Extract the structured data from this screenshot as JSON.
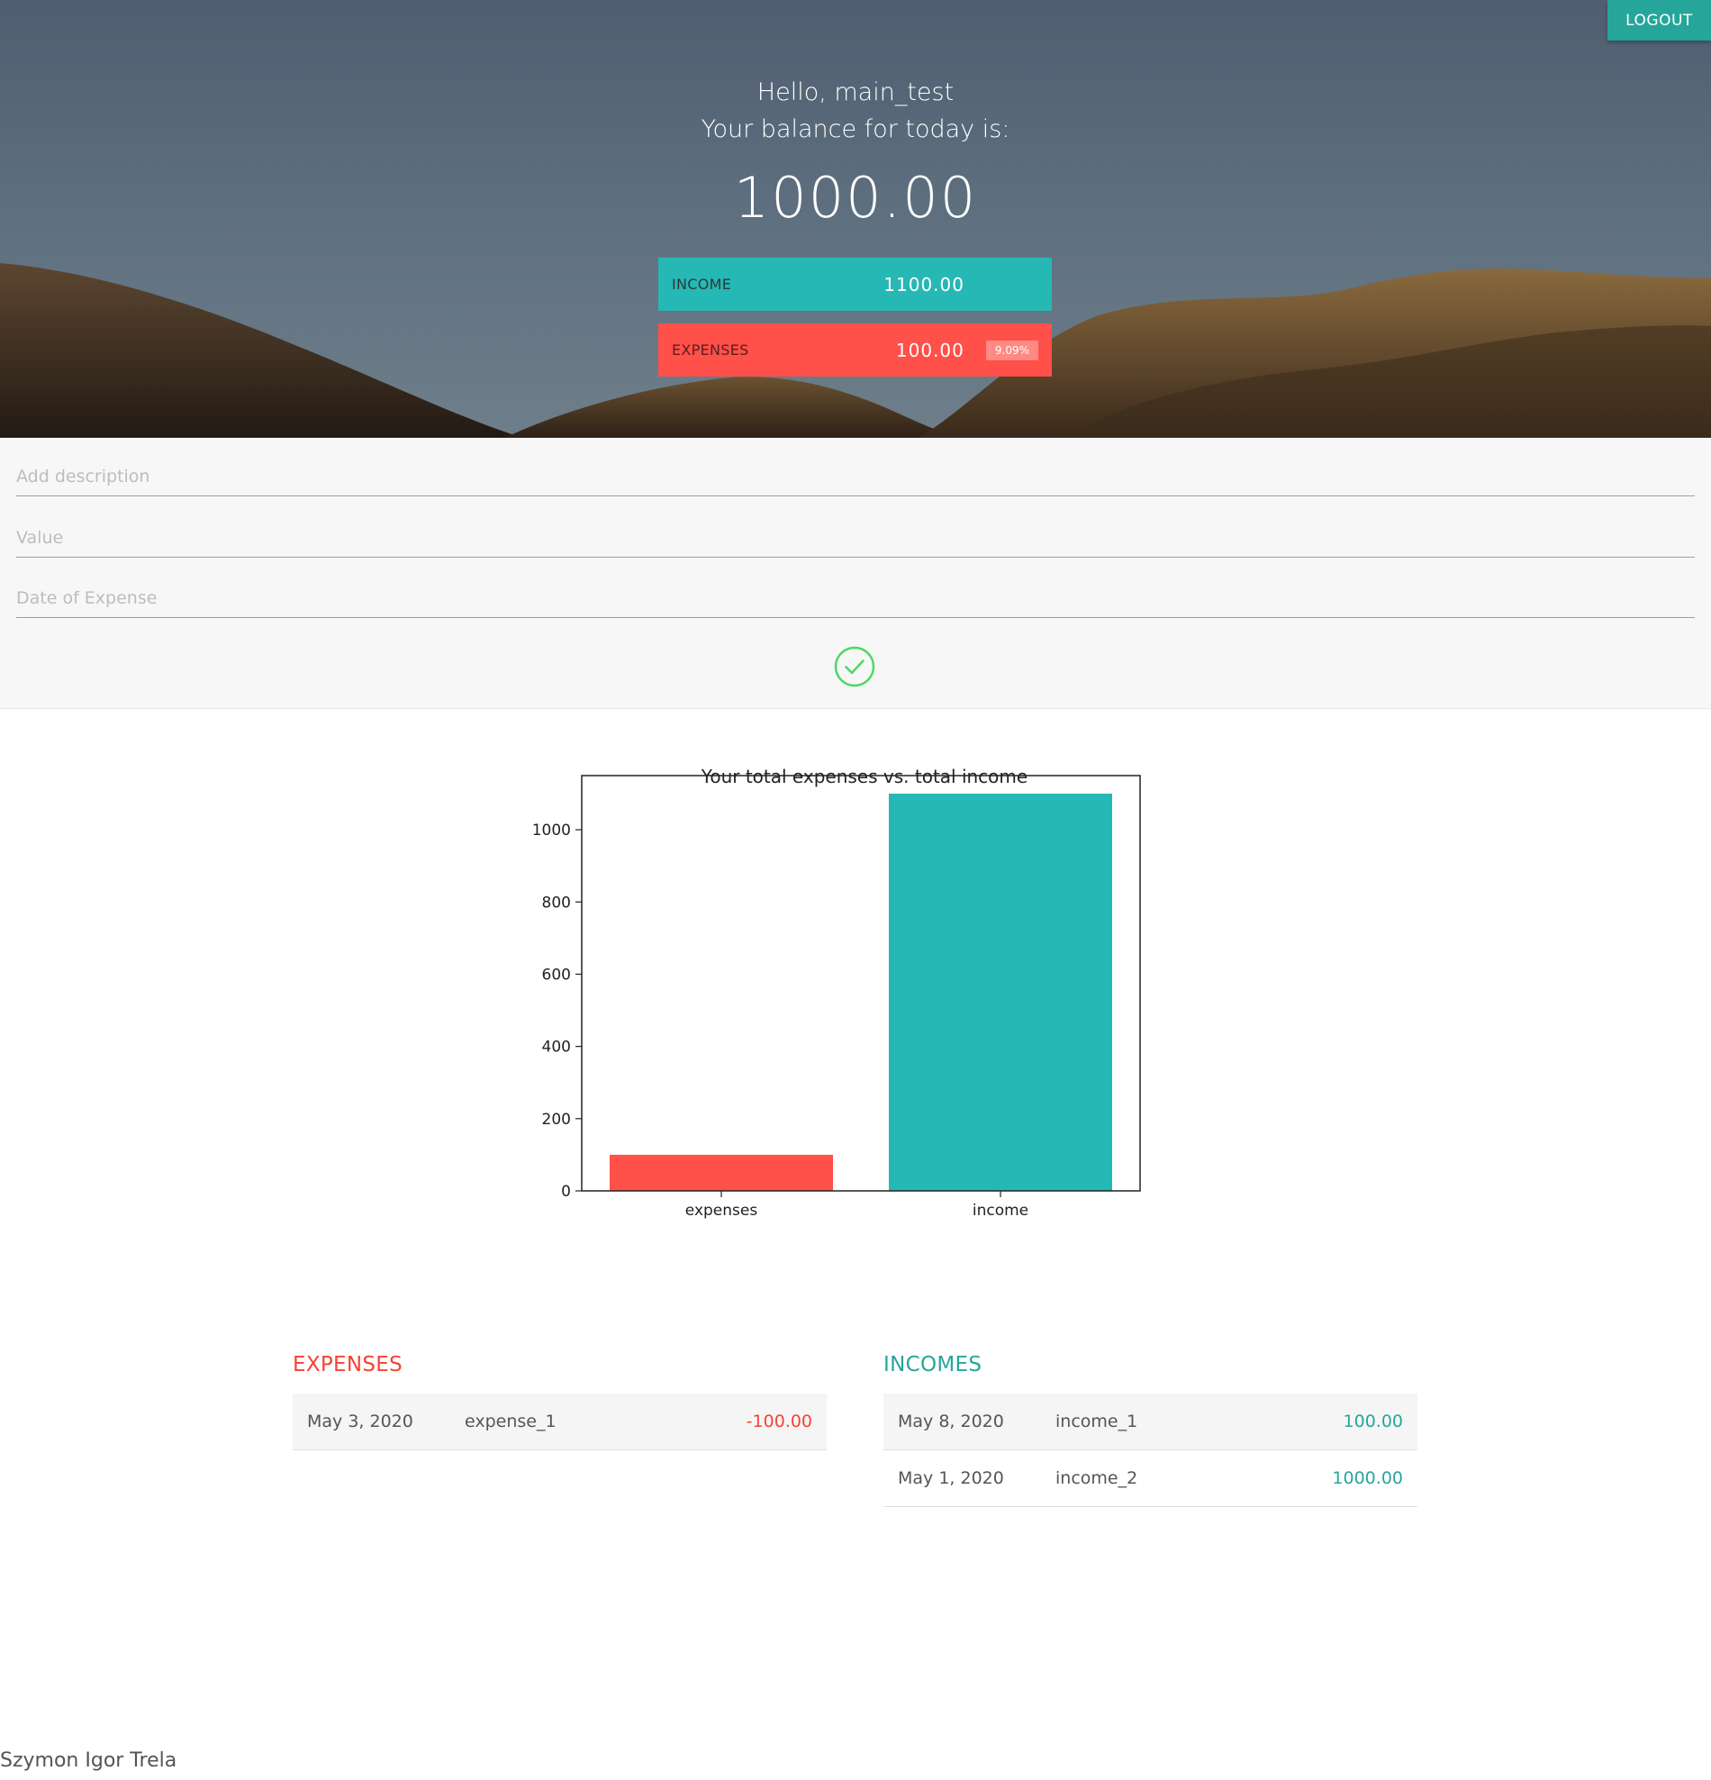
{
  "header": {
    "logout_label": "LOGOUT",
    "greeting_line1": "Hello, main_test",
    "greeting_line2": "Your balance for today is:",
    "balance": "1000.00",
    "income_label": "INCOME",
    "income_value": "1100.00",
    "expenses_label": "EXPENSES",
    "expenses_value": "100.00",
    "expenses_percent": "9.09%"
  },
  "form": {
    "description_placeholder": "Add description",
    "value_placeholder": "Value",
    "date_placeholder": "Date of Expense",
    "submit_icon": "check-circle-icon"
  },
  "chart_data": {
    "type": "bar",
    "title": "Your total expenses vs. total income",
    "categories": [
      "expenses",
      "income"
    ],
    "values": [
      100,
      1100
    ],
    "colors": [
      "#ff5049",
      "#26b8b4"
    ],
    "ylim": [
      0,
      1150
    ],
    "yticks": [
      0,
      200,
      400,
      600,
      800,
      1000
    ],
    "grid": false
  },
  "lists": {
    "expenses_title": "EXPENSES",
    "expenses": [
      {
        "date": "May 3, 2020",
        "description": "expense_1",
        "amount": "-100.00"
      }
    ],
    "incomes_title": "INCOMES",
    "incomes": [
      {
        "date": "May 8, 2020",
        "description": "income_1",
        "amount": "100.00"
      },
      {
        "date": "May 1, 2020",
        "description": "income_2",
        "amount": "1000.00"
      }
    ]
  },
  "footer": {
    "author": "Szymon Igor Trela"
  },
  "colors": {
    "accent": "#26a69a",
    "income": "#26b8b4",
    "expense": "#ff5049",
    "success": "#4cd964"
  }
}
